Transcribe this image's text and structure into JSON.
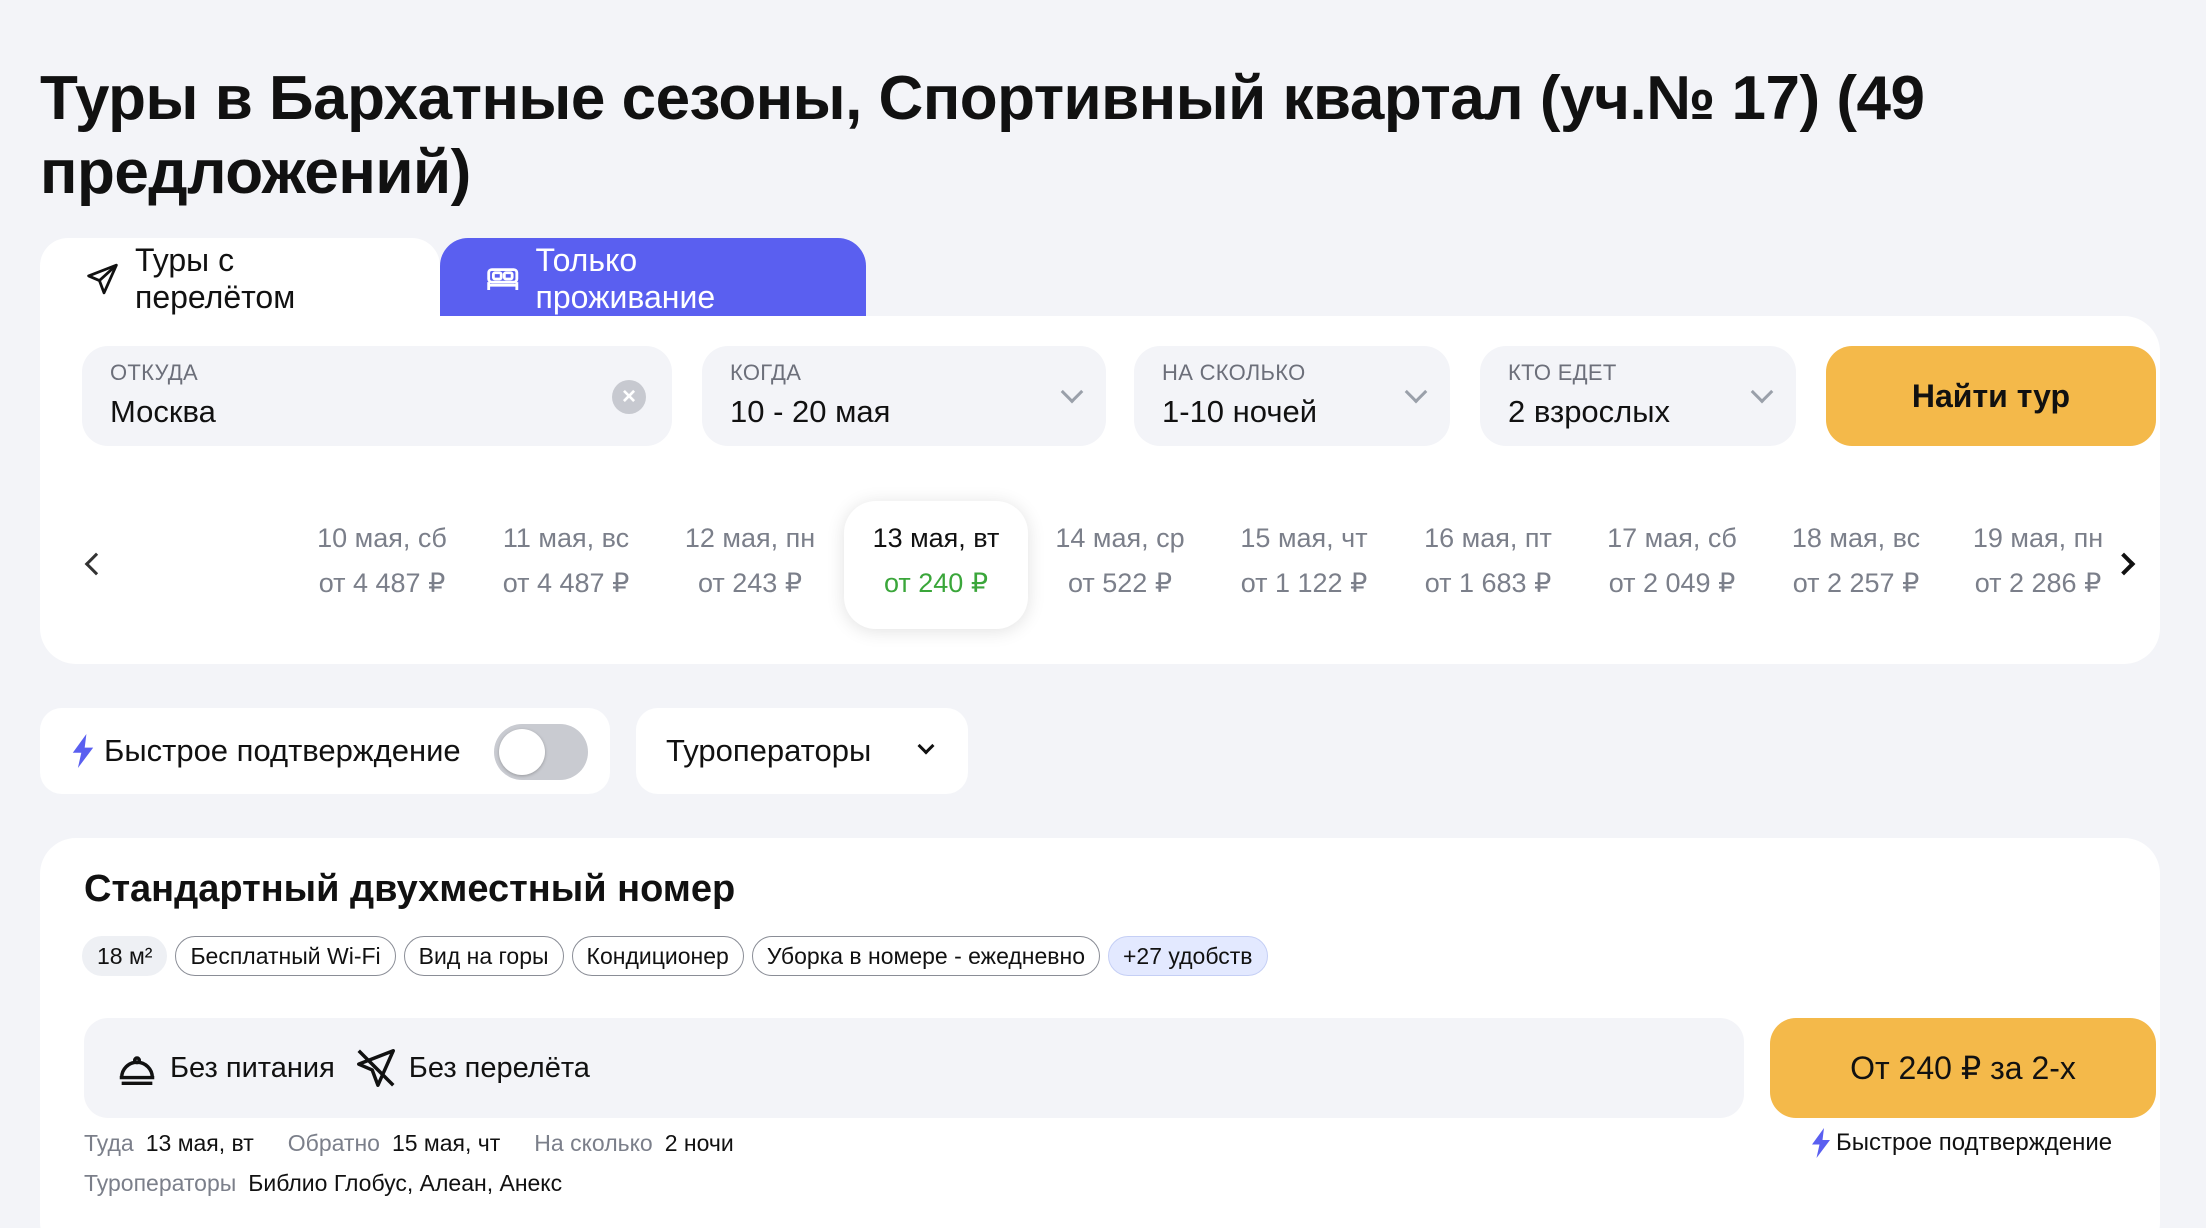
{
  "title": "Туры в Бархатные сезоны, Спортивный квартал (уч.№ 17) (49 предложений)",
  "tabs": {
    "flight": "Туры с перелётом",
    "stay": "Только проживание"
  },
  "search": {
    "from": {
      "label": "Откуда",
      "value": "Москва"
    },
    "when": {
      "label": "Когда",
      "value": "10 - 20 мая"
    },
    "nights": {
      "label": "На сколько",
      "value": "1-10 ночей"
    },
    "who": {
      "label": "Кто едет",
      "value": "2 взрослых"
    },
    "button": "Найти тур"
  },
  "dates": [
    {
      "date": "10 мая, сб",
      "price": "от 4 487 ₽"
    },
    {
      "date": "11 мая, вс",
      "price": "от 4 487 ₽"
    },
    {
      "date": "12 мая, пн",
      "price": "от 243 ₽"
    },
    {
      "date": "13 мая, вт",
      "price": "от 240 ₽"
    },
    {
      "date": "14 мая, ср",
      "price": "от 522 ₽"
    },
    {
      "date": "15 мая, чт",
      "price": "от 1 122 ₽"
    },
    {
      "date": "16 мая, пт",
      "price": "от 1 683 ₽"
    },
    {
      "date": "17 мая, сб",
      "price": "от 2 049 ₽"
    },
    {
      "date": "18 мая, вс",
      "price": "от 2 257 ₽"
    },
    {
      "date": "19 мая, пн",
      "price": "от 2 286 ₽"
    }
  ],
  "active_date_index": 3,
  "filters": {
    "fast": "Быстрое подтверждение",
    "fast_enabled": false,
    "operators": "Туроператоры"
  },
  "room": {
    "title": "Стандартный двухместный номер",
    "amenities": [
      "18 м²",
      "Бесплатный Wi-Fi",
      "Вид на горы",
      "Кондиционер",
      "Уборка в номере - ежедневно",
      "+27 удобств"
    ],
    "meal": "Без питания",
    "flight": "Без перелёта",
    "price_button": "От 240 ₽ за 2-х",
    "fast_note": "Быстрое подтверждение",
    "there_label": "Туда",
    "there_value": "13 мая, вт",
    "back_label": "Обратно",
    "back_value": "15 мая, чт",
    "nights_label": "На сколько",
    "nights_value": "2 ночи",
    "operators_label": "Туроператоры",
    "operators_value": "Библио Глобус, Алеан, Анекс"
  },
  "colors": {
    "accent": "#5a5ff0",
    "button": "#f4b94a",
    "price_green": "#3aa63a",
    "background": "#f3f4f8"
  }
}
